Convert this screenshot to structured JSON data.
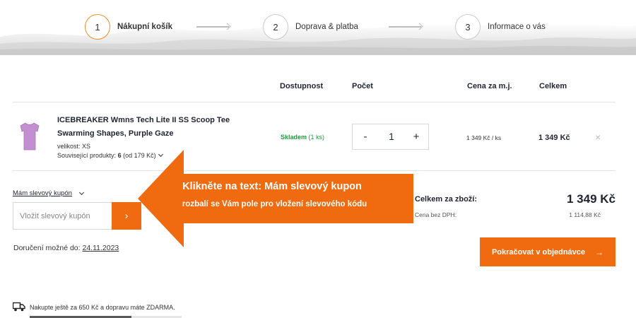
{
  "steps": [
    {
      "number": "1",
      "label": "Nákupní košík",
      "active": true
    },
    {
      "number": "2",
      "label": "Doprava & platba",
      "active": false
    },
    {
      "number": "3",
      "label": "Informace o vás",
      "active": false
    }
  ],
  "table": {
    "headers": {
      "availability": "Dostupnost",
      "quantity": "Počet",
      "unit_price": "Cena za m.j.",
      "total": "Celkem"
    }
  },
  "item": {
    "name": "ICEBREAKER Wmns Tech Lite II SS Scoop Tee Swarming Shapes, Purple Gaze",
    "variant": "velikost: XS",
    "related_prefix": "Související produkty:",
    "related_count": "6",
    "related_from": "(od 179 Kč)",
    "stock_label": "Skladem",
    "stock_count": "(1 ks)",
    "qty_minus": "-",
    "quantity": "1",
    "qty_plus": "+",
    "unit_price": "1 349 Kč / ks",
    "total": "1 349 Kč",
    "remove_glyph": "×",
    "image_color": "#c48fd0"
  },
  "coupon": {
    "toggle_label": "Mám slevový kupón",
    "placeholder": "Vložit slevový kupón",
    "submit_glyph": "›"
  },
  "delivery": {
    "label": "Doručení možné do:",
    "date": "24.11.2023"
  },
  "callout": {
    "title": "Klikněte na text: Mám slevový kupon",
    "subtitle": "rozbalí se Vám pole pro vložení slevového kódu",
    "color": "#f06a0f"
  },
  "summary": {
    "total_label": "Celkem za zboží:",
    "total_value": "1 349 Kč",
    "vat_label": "Cena bez DPH:",
    "vat_value": "1 114,88 Kč"
  },
  "continue_button": {
    "label": "Pokračovat v objednávce",
    "arrow": "→"
  },
  "free_shipping": {
    "text": "Nakupte ještě za 650 Kč a dopravu máte ZDARMA.",
    "progress": 0.67
  },
  "colors": {
    "accent": "#f06a0f",
    "stock_green": "#1e9e3d"
  }
}
